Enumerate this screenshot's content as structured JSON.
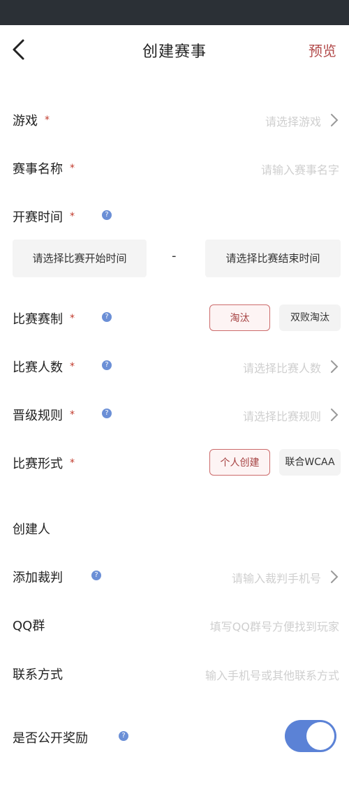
{
  "header": {
    "title": "创建赛事",
    "preview": "预览"
  },
  "form": {
    "game": {
      "label": "游戏",
      "required": "*",
      "placeholder": "请选择游戏"
    },
    "name": {
      "label": "赛事名称",
      "required": "*",
      "placeholder": "请输入赛事名字"
    },
    "start_time": {
      "label": "开赛时间",
      "required": "*",
      "help": "?",
      "start_placeholder": "请选择比赛开始时间",
      "separator": "-",
      "end_placeholder": "请选择比赛结束时间"
    },
    "format": {
      "label": "比赛赛制",
      "required": "*",
      "help": "?",
      "options": [
        "淘汰",
        "双败淘汰"
      ],
      "selected": "淘汰"
    },
    "players": {
      "label": "比赛人数",
      "required": "*",
      "help": "?",
      "placeholder": "请选择比赛人数"
    },
    "promotion": {
      "label": "晋级规则",
      "required": "*",
      "help": "?",
      "placeholder": "请选择比赛规则"
    },
    "type": {
      "label": "比赛形式",
      "required": "*",
      "options": [
        "个人创建",
        "联合WCAA"
      ],
      "selected": "个人创建"
    },
    "creator": {
      "label": "创建人"
    },
    "referee": {
      "label": "添加裁判",
      "help": "?",
      "placeholder": "请输入裁判手机号"
    },
    "qq": {
      "label": "QQ群",
      "placeholder": "填写QQ群号方便找到玩家"
    },
    "contact": {
      "label": "联系方式",
      "placeholder": "输入手机号或其他联系方式"
    },
    "public_reward": {
      "label": "是否公开奖励",
      "help": "?",
      "enabled": true
    }
  },
  "colors": {
    "accent": "#b24a4a",
    "toggle": "#5b82d6",
    "help": "#6b8fd6",
    "status_bar": "#2b3036"
  }
}
